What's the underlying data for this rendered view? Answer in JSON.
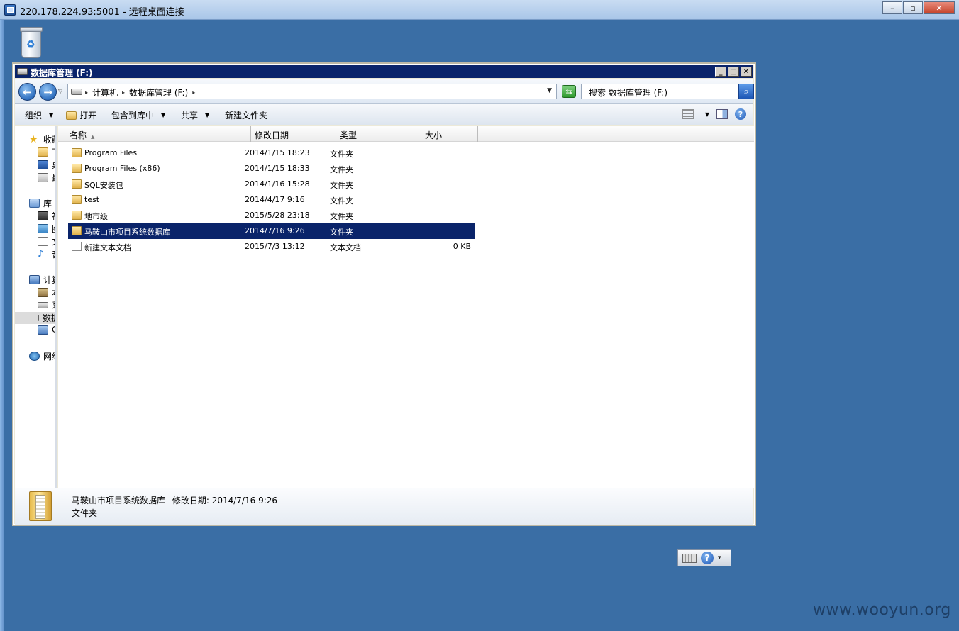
{
  "rdp": {
    "title": "220.178.224.93:5001 - 远程桌面连接",
    "controls": {
      "minimize": "–",
      "restore": "▫",
      "close": "✕"
    }
  },
  "desktop": {
    "recycle_icon": "recycle-bin-icon"
  },
  "window": {
    "title": "数据库管理 (F:)",
    "controls": {
      "minimize": "_",
      "maximize": "□",
      "close": "✕"
    }
  },
  "address": {
    "back": "←",
    "forward": "→",
    "crumbs": [
      "计算机",
      "数据库管理 (F:)"
    ],
    "search_placeholder": "搜索 数据库管理 (F:)"
  },
  "toolbar": {
    "organize": "组织",
    "open": "打开",
    "include_library": "包含到库中",
    "share": "共享",
    "new_folder": "新建文件夹",
    "help": "?"
  },
  "navpane": {
    "favorites": "收藏夹",
    "fav_downloads": "下载",
    "fav_desktop": "桌面",
    "fav_recent": "最近访问的位置",
    "libraries": "库",
    "lib_video": "视频",
    "lib_pictures": "图片",
    "lib_docs": "文档",
    "lib_music": "音乐",
    "computer": "计算机",
    "comp_local": "本地磁盘",
    "comp_system": "系统",
    "comp_db": "数据库管理",
    "comp_c": "C",
    "network": "网络"
  },
  "columns": {
    "name": "名称",
    "date": "修改日期",
    "type": "类型",
    "size": "大小"
  },
  "files": [
    {
      "name": "Program Files",
      "date": "2014/1/15 18:23",
      "type": "文件夹",
      "size": ""
    },
    {
      "name": "Program Files (x86)",
      "date": "2014/1/15 18:33",
      "type": "文件夹",
      "size": ""
    },
    {
      "name": "SQL安装包",
      "date": "2014/1/16 15:28",
      "type": "文件夹",
      "size": ""
    },
    {
      "name": "test",
      "date": "2014/4/17 9:16",
      "type": "文件夹",
      "size": ""
    },
    {
      "name": "地市级",
      "date": "2015/5/28 23:18",
      "type": "文件夹",
      "size": ""
    },
    {
      "name": "马鞍山市项目系统数据库",
      "date": "2014/7/16 9:26",
      "type": "文件夹",
      "size": ""
    },
    {
      "name": "新建文本文档",
      "date": "2015/7/3 13:12",
      "type": "文本文档",
      "size": "0 KB"
    }
  ],
  "details": {
    "name": "马鞍山市项目系统数据库",
    "date_label": "修改日期:",
    "date": "2014/7/16 9:26",
    "type": "文件夹"
  },
  "langbar": {
    "help": "?",
    "options": "▾"
  },
  "watermark": "www.wooyun.org"
}
